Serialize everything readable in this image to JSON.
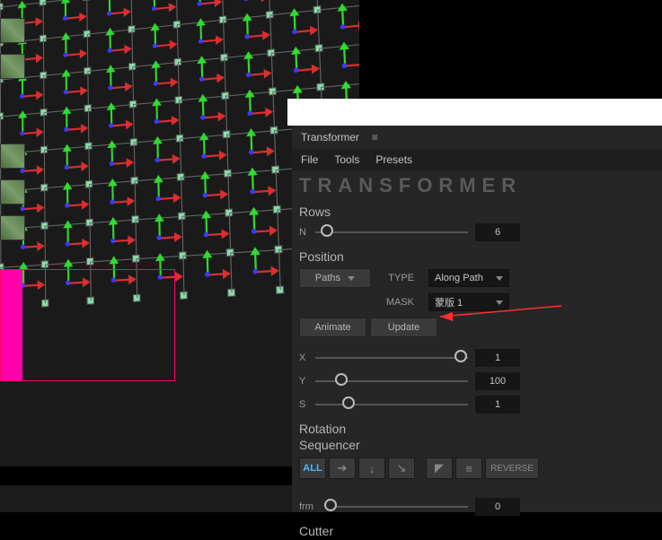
{
  "panel": {
    "title": "Transformer",
    "menu": {
      "file": "File",
      "tools": "Tools",
      "presets": "Presets"
    },
    "logo": "TRANSFORMER"
  },
  "rows": {
    "heading": "Rows",
    "n_label": "N",
    "n_value": "6"
  },
  "position": {
    "heading": "Position",
    "paths_label": "Paths",
    "type_label": "TYPE",
    "type_value": "Along Path",
    "mask_label": "MASK",
    "mask_value": "蒙版 1",
    "animate": "Animate",
    "update": "Update",
    "x_label": "X",
    "x_value": "1",
    "y_label": "Y",
    "y_value": "100",
    "s_label": "S",
    "s_value": "1"
  },
  "rotation": {
    "heading": "Rotation",
    "sequencer": "Sequencer",
    "all": "ALL",
    "reverse": "REVERSE",
    "frm_label": "frm",
    "frm_value": "0"
  },
  "cutter": {
    "heading": "Cutter"
  }
}
